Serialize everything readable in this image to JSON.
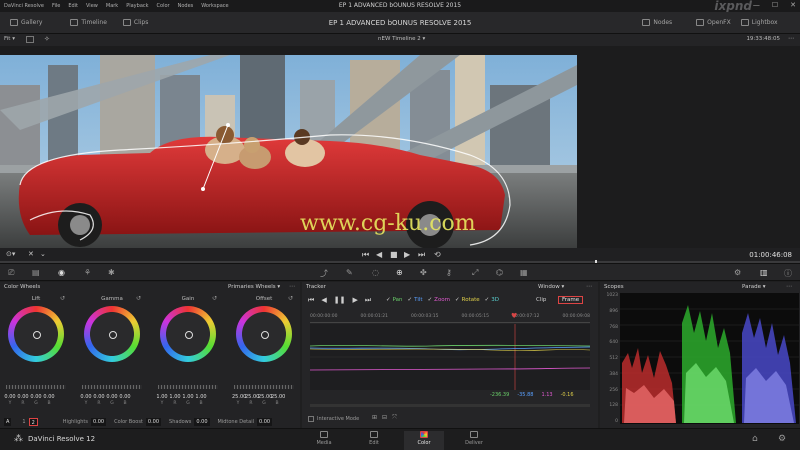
{
  "menubar": {
    "items": [
      "DaVinci Resolve",
      "File",
      "Edit",
      "View",
      "Mark",
      "Playback",
      "Color",
      "Nodes",
      "Workspace"
    ],
    "window_title": "EP 1 ADVANCED  bOUNUS  RESOLVE 2015"
  },
  "watermark_corner": "ixpnd",
  "toolbar": {
    "gallery": "Gallery",
    "timeline": "Timeline",
    "clips": "Clips",
    "project_title": "EP 1 ADVANCED  bOUNUS  RESOLVE 2015",
    "nodes": "Nodes",
    "openfx": "OpenFX",
    "lightbox": "Lightbox"
  },
  "viewer": {
    "fit": "Fit",
    "timeline_name": "nEW Timeline 2",
    "timecode_top": "19:33:48:05",
    "timecode_bottom": "01:00:46:08",
    "watermark": "www.cg-ku.com"
  },
  "color_wheels": {
    "title": "Color Wheels",
    "mode": "Primaries Wheels",
    "wheels": [
      {
        "name": "Lift",
        "values": [
          "0.00",
          "0.00",
          "0.00",
          "0.00"
        ]
      },
      {
        "name": "Gamma",
        "values": [
          "0.00",
          "0.00",
          "0.00",
          "0.00"
        ]
      },
      {
        "name": "Gain",
        "values": [
          "1.00",
          "1.00",
          "1.00",
          "1.00"
        ]
      },
      {
        "name": "Offset",
        "values": [
          "25.00",
          "25.00",
          "25.00",
          "25.00"
        ]
      }
    ],
    "channels": [
      "Y",
      "R",
      "G",
      "B"
    ],
    "footer": {
      "a": "A",
      "p1": "1",
      "p2": "2",
      "highlights_label": "Highlights",
      "highlights": "0.00",
      "color_boost_label": "Color Boost",
      "color_boost": "0.00",
      "shadows_label": "Shadows",
      "shadows": "0.00",
      "midtone_label": "Midtone Detail",
      "midtone": "0.00"
    }
  },
  "tracker": {
    "title": "Tracker",
    "mode": "Window",
    "options": [
      "Pan",
      "Tilt",
      "Zoom",
      "Rotate",
      "3D"
    ],
    "clip": "Clip",
    "frame": "Frame",
    "ruler": [
      "00:00:00:00",
      "00:00:01:21",
      "00:00:03:15",
      "00:00:05:15",
      "00:00:07:12",
      "00:00:09:08"
    ],
    "values": [
      "-236.39",
      "-35.88",
      "1.13",
      "-0.16"
    ],
    "interactive_mode": "Interactive Mode"
  },
  "scopes": {
    "title": "Scopes",
    "mode": "Parade",
    "axis": [
      "1023",
      "896",
      "768",
      "640",
      "512",
      "384",
      "256",
      "128",
      "0"
    ]
  },
  "bottom": {
    "app_name": "DaVinci Resolve 12",
    "pages": [
      "Media",
      "Edit",
      "Color",
      "Deliver"
    ],
    "active_page": "Color"
  },
  "colors": {
    "accent": "#d84545",
    "pan": "#6ad06a",
    "tilt": "#5aa0ff",
    "zoom": "#e05ad0",
    "rotate": "#e0d04a",
    "threed": "#5ad0d0"
  }
}
